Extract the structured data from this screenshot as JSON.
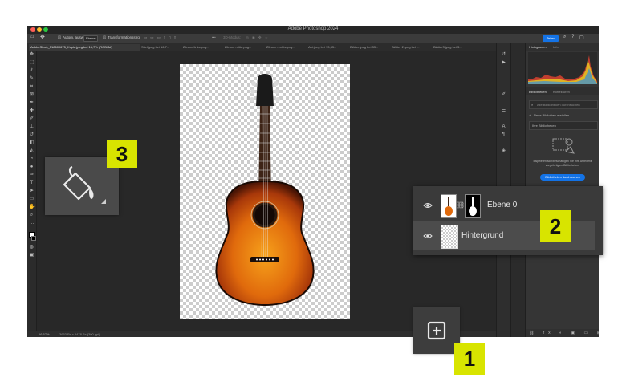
{
  "app": {
    "window_title": "Adobe Photoshop 2024",
    "share_button": "Teilen",
    "traffic_lights": [
      "#ff5f57",
      "#febc2e",
      "#28c840"
    ]
  },
  "options_bar": {
    "auto_select_label": "Autom. ausw.:",
    "auto_select_value": "Ebene",
    "transform_label": "Transformationsstrg.",
    "mode_label": "3D-Modus:"
  },
  "doc_tabs": [
    "AdobeStock_518600675_Kopie.jpeg bei 16,7% (RGB/8#)",
    "Stiel.jpeg bei 16,7...",
    "Zitrone links.png...",
    "Zitrone mitte.png...",
    "Zitrone rechts.png...",
    "Ast.jpeg bei 13,33...",
    "Blätter.jpeg bei 33...",
    "Blätter 2.jpeg bei ...",
    "Blätter3.jpeg bei 3..."
  ],
  "status": {
    "zoom": "16,67%",
    "doc_info": "3653 Px x 5478 Px (300 ppi)"
  },
  "right_panel": {
    "histogram_tab": "Histogramm",
    "info_tab": "Info",
    "libraries_tab": "Bibliotheken",
    "adjustments_tab": "Korrekturen",
    "search_placeholder": "Alle Bibliotheken durchsuchen",
    "new_library": "Neue Bibliothek erstellen",
    "your_libraries": "Ihre Bibliotheken",
    "promo_text": "Inspirieren sich/beschäftigen Sie Ihre Arbeit mit vorgefertigten Bibliotheken.",
    "browse_button": "Bibliotheken durchsuchen"
  },
  "layers": [
    {
      "name": "Ebene 0"
    },
    {
      "name": "Hintergrund"
    }
  ],
  "badges": {
    "one": "1",
    "two": "2",
    "three": "3"
  },
  "colors": {
    "badge": "#d8e400",
    "accent": "#1473e6"
  }
}
